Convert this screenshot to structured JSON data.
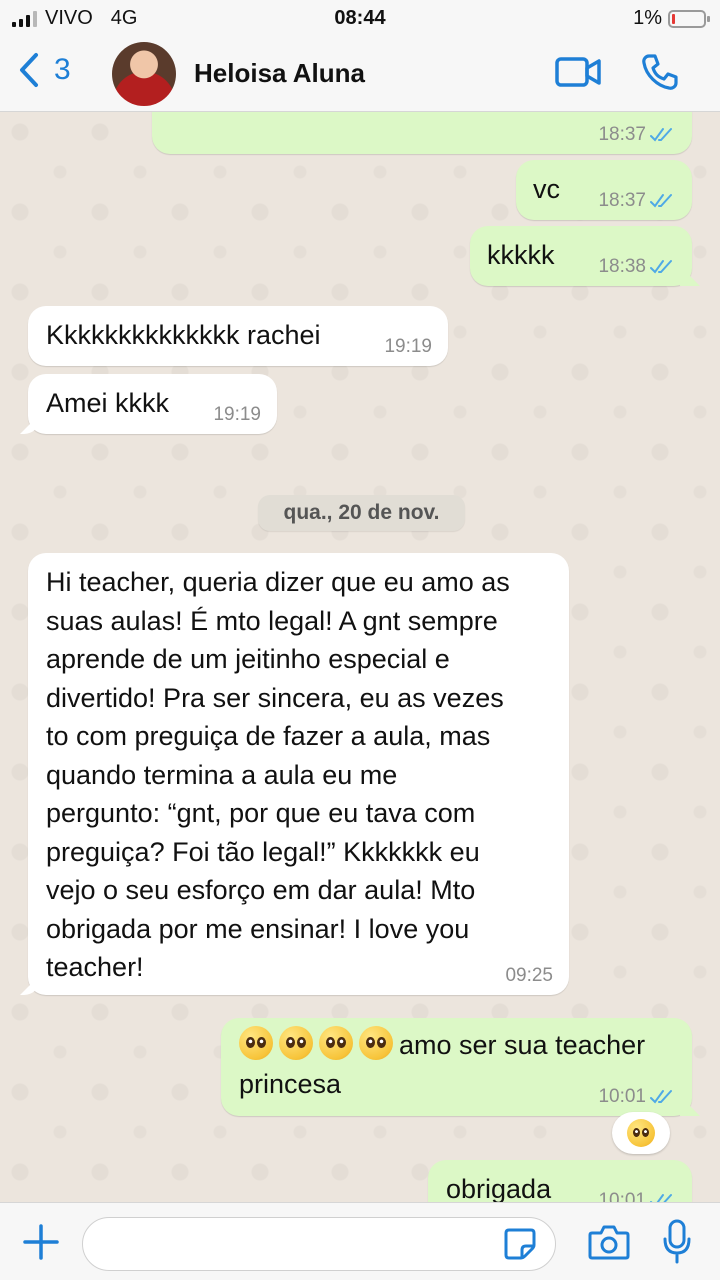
{
  "status_bar": {
    "carrier": "VIVO",
    "network": "4G",
    "time": "08:44",
    "battery": "1%"
  },
  "header": {
    "back_count": "3",
    "contact_name": "Heloisa Aluna"
  },
  "messages": [
    {
      "direction": "out",
      "text": "",
      "time": "18:37",
      "status": "read"
    },
    {
      "direction": "out",
      "text": "vc",
      "time": "18:37",
      "status": "read"
    },
    {
      "direction": "out",
      "text": "kkkkk",
      "time": "18:38",
      "status": "read"
    },
    {
      "direction": "in",
      "text": "Kkkkkkkkkkkkkk rachei",
      "time": "19:19"
    },
    {
      "direction": "in",
      "text": "Amei kkkk",
      "time": "19:19"
    },
    {
      "direction": "in",
      "lines": [
        "Hi teacher, queria dizer que eu amo as",
        "suas aulas! É mto legal! A gnt sempre",
        "aprende de um jeitinho especial e",
        "divertido! Pra ser sincera, eu as vezes",
        "to com preguiça de fazer a aula, mas",
        "quando termina a aula eu me",
        "pergunto: “gnt, por que eu tava com",
        "preguiça? Foi tão legal!” Kkkkkkk eu",
        "vejo o seu esforço em dar aula! Mto",
        "obrigada por me ensinar! I love you",
        "teacher!"
      ],
      "time": "09:25"
    },
    {
      "direction": "out",
      "emoji": "🥹🥹🥹🥹",
      "line1": "amo ser sua teacher",
      "line2": "princesa",
      "time": "10:01",
      "status": "read",
      "reaction": "🥹"
    },
    {
      "direction": "out",
      "text": "obrigada",
      "time": "10:01",
      "status": "read"
    }
  ],
  "date_divider": "qua., 20 de nov.",
  "colors": {
    "accent": "#1e7fd6",
    "outgoing_bubble": "#dcf8c6",
    "incoming_bubble": "#ffffff",
    "read_ticks": "#4fa9e6",
    "chat_background": "#ece5dd"
  },
  "icons": [
    "back-chevron-icon",
    "video-call-icon",
    "phone-icon",
    "plus-icon",
    "sticker-icon",
    "camera-icon",
    "microphone-icon"
  ],
  "input": {
    "placeholder": "",
    "value": ""
  }
}
